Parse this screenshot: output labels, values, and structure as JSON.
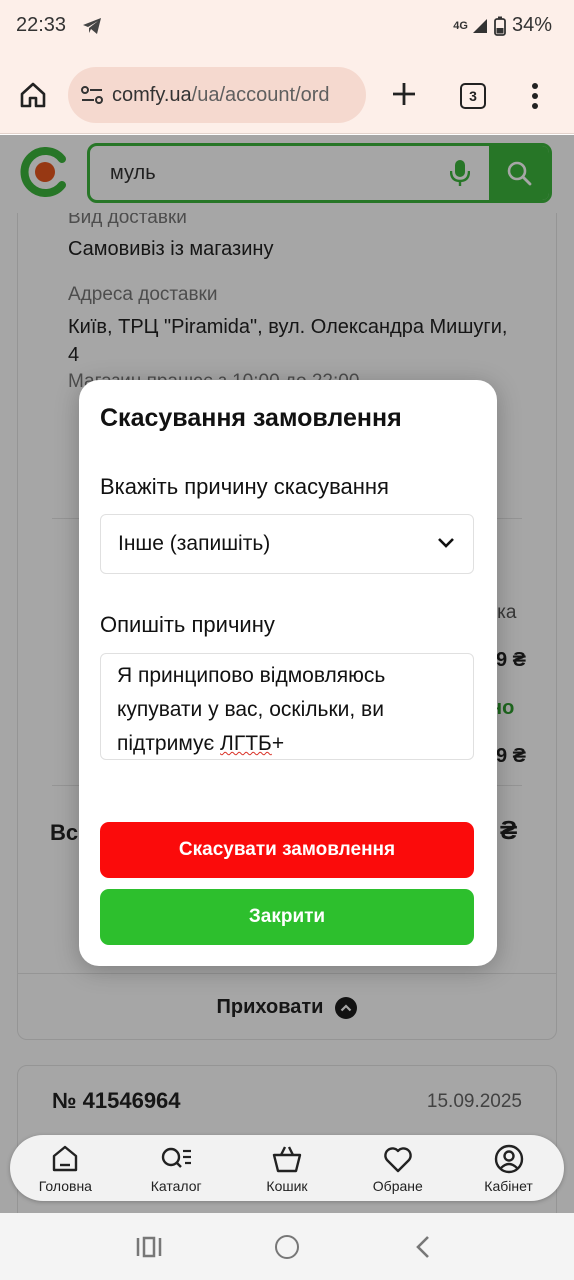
{
  "status_bar": {
    "time": "22:33",
    "network": "4G",
    "battery": "34%"
  },
  "browser": {
    "url_host": "comfy.ua",
    "url_path": "/ua/account/ord",
    "tab_count": "3"
  },
  "site": {
    "search_value": "муль"
  },
  "order_details": {
    "delivery_type_label": "Вид доставки",
    "delivery_type_value": "Самовивіз із магазину",
    "address_label": "Адреса доставки",
    "address_line1": "Київ, ТРЦ \"Piramida\", вул. Олександра Мишуги,",
    "address_line2": "4",
    "hours_partial": "Магазин працює з 10:00 до 22:00",
    "total_partial": "Вс",
    "right_partial_1": "вка",
    "right_partial_2": "9 ₴",
    "right_partial_3": "но",
    "right_partial_4": "9 ₴",
    "currency": "₴",
    "hide_label": "Приховати"
  },
  "next_order": {
    "number": "№ 41546964",
    "date": "15.09.2025"
  },
  "bottom_nav": [
    {
      "label": "Головна",
      "icon": "home-icon"
    },
    {
      "label": "Каталог",
      "icon": "catalog-icon"
    },
    {
      "label": "Кошик",
      "icon": "cart-icon"
    },
    {
      "label": "Обране",
      "icon": "heart-icon"
    },
    {
      "label": "Кабінет",
      "icon": "user-icon"
    }
  ],
  "modal": {
    "title": "Скасування замовлення",
    "reason_label": "Вкажіть причину скасування",
    "reason_selected": "Інше (запишіть)",
    "describe_label": "Опишіть причину",
    "describe_text_part1": "Я принципово відмовляюсь купувати у вас, оскільки, ви підтримує ",
    "describe_text_flagged": "ЛГТБ",
    "describe_text_part2": "+",
    "cancel_button": "Скасувати замовлення",
    "close_button": "Закрити"
  },
  "colors": {
    "accent_green": "#3cb63c",
    "cancel_red": "#fb0b0b",
    "close_green": "#2dbf2d",
    "logo_orange": "#e8561e"
  }
}
